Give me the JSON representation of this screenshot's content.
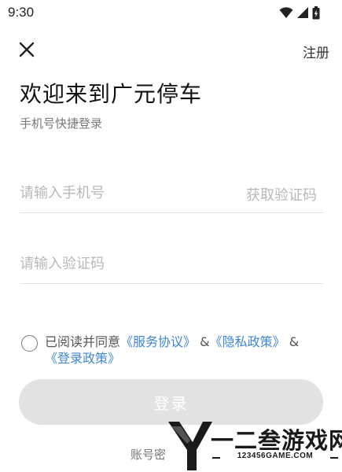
{
  "status_bar": {
    "time": "9:30"
  },
  "header": {
    "register_label": "注册"
  },
  "welcome": {
    "title": "欢迎来到广元停车",
    "subtitle": "手机号快捷登录"
  },
  "phone_field": {
    "placeholder": "请输入手机号",
    "value": "",
    "get_code_label": "获取验证码"
  },
  "code_field": {
    "placeholder": "请输入验证码",
    "value": ""
  },
  "agreement": {
    "checked": false,
    "prefix": "已阅读并同意",
    "service_link": "《服务协议》",
    "amp1": "&",
    "privacy_link": "《隐私政策》",
    "amp2": "&",
    "login_policy_link": "《登录政策》"
  },
  "login_button": {
    "label": "登录"
  },
  "password_login": {
    "label": "账号密"
  },
  "watermark": {
    "name": "一二叁游戏网",
    "url": "123456GAME.COM"
  },
  "colors": {
    "link": "#3d86d6",
    "button_disabled": "#e2e2e2",
    "placeholder": "#b8b8b8"
  }
}
